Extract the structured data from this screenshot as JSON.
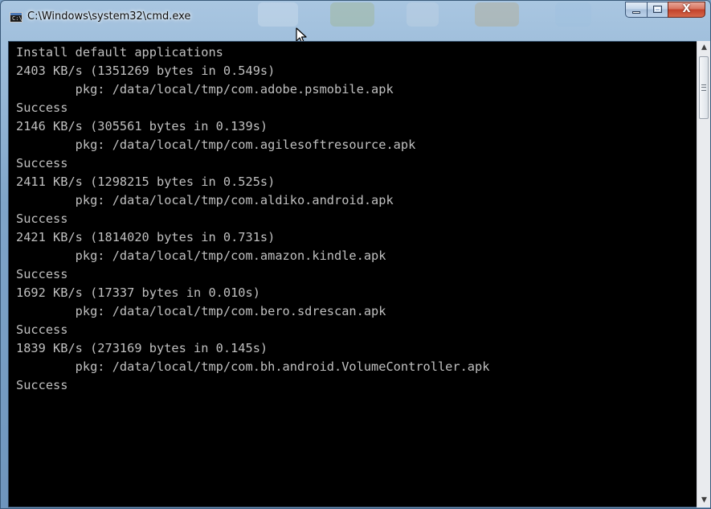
{
  "window": {
    "title": "C:\\Windows\\system32\\cmd.exe",
    "icon_name": "cmd-app-icon",
    "controls": {
      "minimize_icon": "minimize-icon",
      "maximize_icon": "maximize-icon",
      "close_label": "X"
    }
  },
  "console": {
    "lines": [
      "Install default applications",
      "2403 KB/s (1351269 bytes in 0.549s)",
      "        pkg: /data/local/tmp/com.adobe.psmobile.apk",
      "Success",
      "2146 KB/s (305561 bytes in 0.139s)",
      "        pkg: /data/local/tmp/com.agilesoftresource.apk",
      "Success",
      "2411 KB/s (1298215 bytes in 0.525s)",
      "        pkg: /data/local/tmp/com.aldiko.android.apk",
      "Success",
      "2421 KB/s (1814020 bytes in 0.731s)",
      "        pkg: /data/local/tmp/com.amazon.kindle.apk",
      "Success",
      "1692 KB/s (17337 bytes in 0.010s)",
      "        pkg: /data/local/tmp/com.bero.sdrescan.apk",
      "Success",
      "1839 KB/s (273169 bytes in 0.145s)",
      "        pkg: /data/local/tmp/com.bh.android.VolumeController.apk",
      "Success"
    ]
  },
  "scrollbar": {
    "up_arrow": "▲",
    "down_arrow": "▼"
  },
  "colors": {
    "console_bg": "#000000",
    "console_text": "#c0c0c0",
    "close_button": "#c2412a"
  }
}
